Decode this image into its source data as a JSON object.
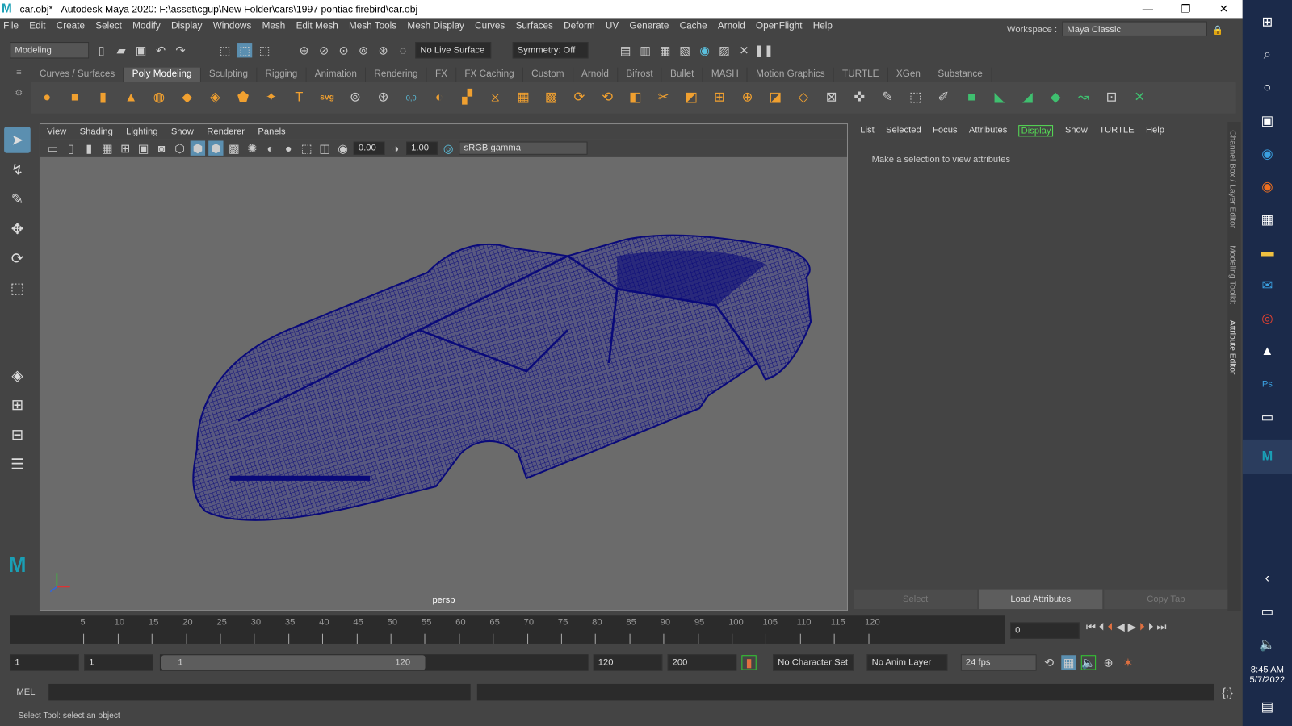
{
  "window": {
    "title": "car.obj* - Autodesk Maya 2020: F:\\asset\\cgup\\New Folder\\cars\\1997 pontiac firebird\\car.obj",
    "logo": "M"
  },
  "menu": [
    "File",
    "Edit",
    "Create",
    "Select",
    "Modify",
    "Display",
    "Windows",
    "Mesh",
    "Edit Mesh",
    "Mesh Tools",
    "Mesh Display",
    "Curves",
    "Surfaces",
    "Deform",
    "UV",
    "Generate",
    "Cache",
    "Arnold",
    "OpenFlight",
    "Help"
  ],
  "workspace": {
    "label": "Workspace :",
    "value": "Maya Classic"
  },
  "toolbar": {
    "mode": "Modeling",
    "live_surface": "No Live Surface",
    "symmetry": "Symmetry: Off"
  },
  "shelf_tabs": [
    "Curves / Surfaces",
    "Poly Modeling",
    "Sculpting",
    "Rigging",
    "Animation",
    "Rendering",
    "FX",
    "FX Caching",
    "Custom",
    "Arnold",
    "Bifrost",
    "Bullet",
    "MASH",
    "Motion Graphics",
    "TURTLE",
    "XGen",
    "Substance"
  ],
  "shelf_icons": {
    "svg": "svg",
    "text": "T",
    "coords": "0,0"
  },
  "viewport": {
    "menu": [
      "View",
      "Shading",
      "Lighting",
      "Show",
      "Renderer",
      "Panels"
    ],
    "exposure": "0.00",
    "gamma": "1.00",
    "colorspace": "sRGB gamma",
    "camera": "persp"
  },
  "attribute_editor": {
    "menu": [
      "List",
      "Selected",
      "Focus",
      "Attributes",
      "Display",
      "Show",
      "TURTLE",
      "Help"
    ],
    "message": "Make a selection to view attributes",
    "buttons": [
      "Select",
      "Load Attributes",
      "Copy Tab"
    ]
  },
  "side_tabs": [
    "Channel Box / Layer Editor",
    "Modeling Toolkit",
    "Attribute Editor"
  ],
  "timeline": {
    "ticks": [
      "5",
      "10",
      "15",
      "20",
      "25",
      "30",
      "35",
      "40",
      "45",
      "50",
      "55",
      "60",
      "65",
      "70",
      "75",
      "80",
      "85",
      "90",
      "95",
      "100",
      "105",
      "110",
      "115",
      "120"
    ],
    "current_frame": "0"
  },
  "range": {
    "start": "1",
    "playback_start": "1",
    "slider_start": "1",
    "slider_end": "120",
    "playback_end": "120",
    "end": "200",
    "character_set": "No Character Set",
    "anim_layer": "No Anim Layer",
    "fps": "24 fps"
  },
  "command": {
    "label": "MEL"
  },
  "status": "Select Tool: select an object",
  "clock": {
    "time": "8:45 AM",
    "date": "5/7/2022"
  },
  "colors": {
    "wire": "#0a0a7a",
    "accent": "#5bc0de",
    "viewport_bg": "#6b6b6b"
  }
}
